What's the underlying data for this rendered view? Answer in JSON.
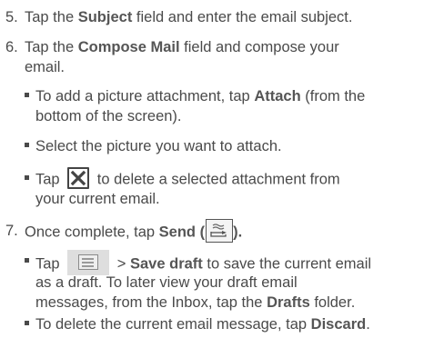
{
  "steps": [
    {
      "number": "5.",
      "text_before": "Tap the ",
      "bold": "Subject",
      "text_after": " field and enter the email subject."
    },
    {
      "number": "6.",
      "line1_before": "Tap the ",
      "bold": "Compose Mail",
      "line1_after": " field and compose your",
      "line2": "email.",
      "bullets": [
        {
          "line1_before": "To add a picture attachment, tap ",
          "bold": "Attach",
          "line1_after": " (from the",
          "line2": "bottom of the screen)."
        },
        {
          "text": "Select the picture you want to attach."
        },
        {
          "before": "Tap ",
          "after": " to delete a selected attachment from",
          "line2": "your current email.",
          "icon": "close-icon"
        }
      ]
    },
    {
      "number": "7.",
      "before": "Once complete, tap ",
      "bold": "Send (",
      "bold_after": ").",
      "icon": "send-icon",
      "bullets": [
        {
          "before": "Tap ",
          "gt": " > ",
          "bold": "Save draft",
          "after": " to save the current email",
          "line2": "as a draft. To later view your draft email",
          "line3_before": "messages, from the Inbox, tap the ",
          "line3_bold": "Drafts",
          "line3_after": " folder.",
          "icon": "menu-icon"
        },
        {
          "before": "To delete the current email message, tap ",
          "bold": "Discard",
          "after": "."
        }
      ]
    }
  ],
  "colors": {
    "text": "#4a4a4a",
    "icon_border": "#444444",
    "menu_bg": "#dedede"
  }
}
